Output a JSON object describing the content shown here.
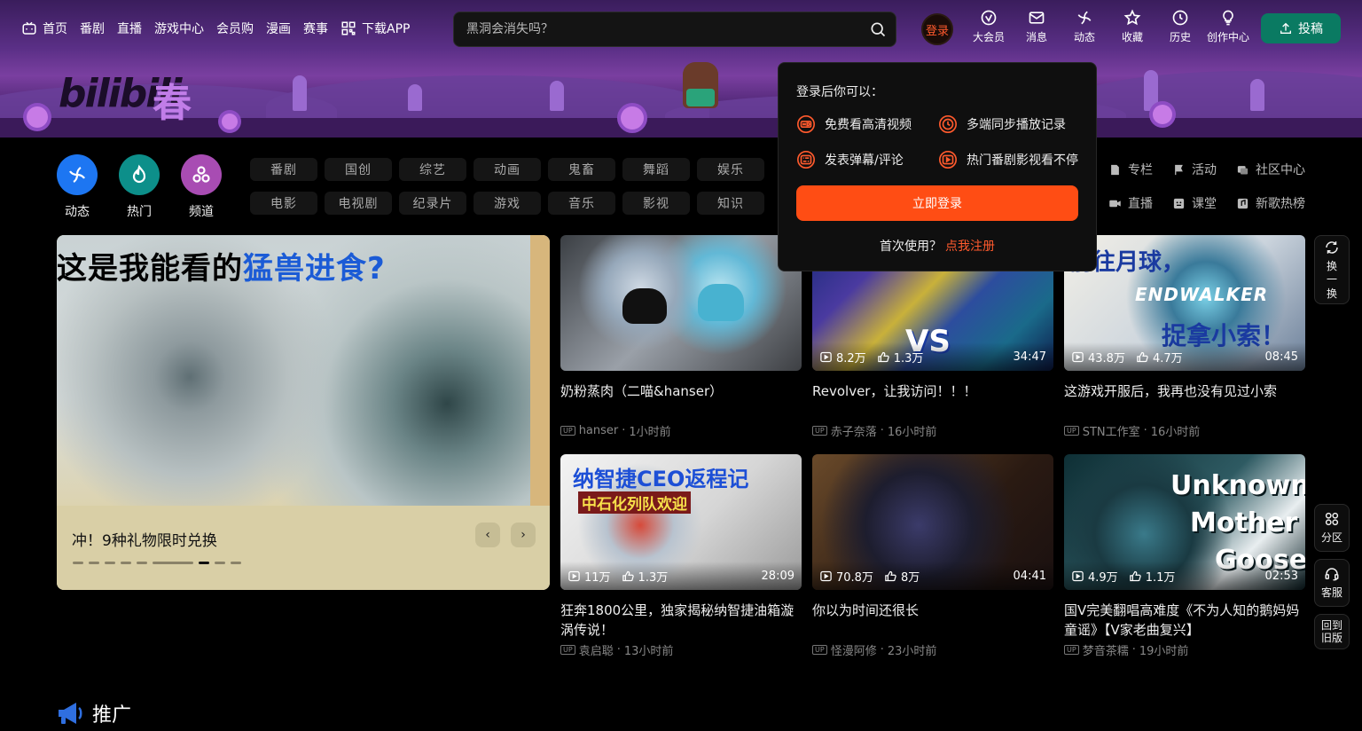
{
  "header": {
    "left_nav": [
      {
        "label": "首页",
        "icon": "bilibili-tv-icon"
      },
      {
        "label": "番剧"
      },
      {
        "label": "直播"
      },
      {
        "label": "游戏中心"
      },
      {
        "label": "会员购"
      },
      {
        "label": "漫画"
      },
      {
        "label": "赛事"
      },
      {
        "label": "下载APP",
        "icon": "qr-grid-icon"
      }
    ],
    "search_placeholder": "黑洞会消失吗？",
    "login_label": "登录",
    "right_nav": [
      {
        "label": "大会员"
      },
      {
        "label": "消息"
      },
      {
        "label": "动态"
      },
      {
        "label": "收藏"
      },
      {
        "label": "历史"
      },
      {
        "label": "创作中心"
      }
    ],
    "upload_label": "投稿",
    "logo_text": "bilibili",
    "logo_sub": "春"
  },
  "channels": {
    "circles": [
      {
        "label": "动态",
        "color": "#1d76f2"
      },
      {
        "label": "热门",
        "color": "#0d8f8a"
      },
      {
        "label": "频道",
        "color": "#a84cb3"
      }
    ],
    "chips_row1": [
      "番剧",
      "国创",
      "综艺",
      "动画",
      "鬼畜",
      "舞蹈",
      "娱乐"
    ],
    "chips_row2": [
      "电影",
      "电视剧",
      "纪录片",
      "游戏",
      "音乐",
      "影视",
      "知识"
    ],
    "extra_row1": [
      "专栏",
      "活动",
      "社区中心"
    ],
    "extra_row2": [
      "直播",
      "课堂",
      "新歌热榜"
    ]
  },
  "carousel": {
    "headline_a": "这是我能看的",
    "headline_b": "猛兽进食?",
    "caption": "冲！9种礼物限时兑换",
    "prev": "‹",
    "next": "›"
  },
  "videos": [
    {
      "title": "奶粉蒸肉（二喵&hanser）",
      "author": "hanser",
      "time": "1小时前",
      "views": "",
      "likes": "",
      "duration": "",
      "thumb": "t1"
    },
    {
      "title": "Revolver，让我访问！！！",
      "author": "赤子奈落",
      "time": "16小时前",
      "views": "8.2万",
      "likes": "1.3万",
      "duration": "34:47",
      "thumb": "t2",
      "overlay": "VS"
    },
    {
      "title": "这游戏开服后，我再也没有见过小索",
      "author": "STN工作室",
      "time": "16小时前",
      "views": "43.8万",
      "likes": "4.7万",
      "duration": "08:45",
      "thumb": "t3",
      "overlay_a": "前往月球，",
      "overlay_b": "ENDWALKER",
      "overlay_c": "捉拿小索！"
    },
    {
      "title": "狂奔1800公里，独家揭秘纳智捷油箱漩涡传说！",
      "author": "袁启聪",
      "time": "13小时前",
      "views": "11万",
      "likes": "1.3万",
      "duration": "28:09",
      "thumb": "t4",
      "overlay_a": "纳智捷CEO返程记",
      "overlay_b": "中石化列队欢迎"
    },
    {
      "title": "你以为时间还很长",
      "author": "怪漫阿修",
      "time": "23小时前",
      "views": "70.8万",
      "likes": "8万",
      "duration": "04:41",
      "thumb": "t5"
    },
    {
      "title": "国V完美翻唱高难度《不为人知的鹅妈妈童谣》【V家老曲复兴】",
      "author": "梦音茶糯",
      "time": "19小时前",
      "views": "4.9万",
      "likes": "1.1万",
      "duration": "02:53",
      "thumb": "t6",
      "overlay_a": "Unknown",
      "overlay_b": "Mother",
      "overlay_c": "Goose"
    }
  ],
  "popup": {
    "heading": "登录后你可以：",
    "benefits": [
      "免费看高清视频",
      "多端同步播放记录",
      "发表弹幕/评论",
      "热门番剧影视看不停"
    ],
    "login_button": "立即登录",
    "first_use": "首次使用？",
    "register_link": "点我注册"
  },
  "floating": {
    "refresh": [
      "换",
      "一",
      "换"
    ],
    "section": "分区",
    "service": "客服",
    "old_version": "回到旧版"
  },
  "promo_title": "推广"
}
